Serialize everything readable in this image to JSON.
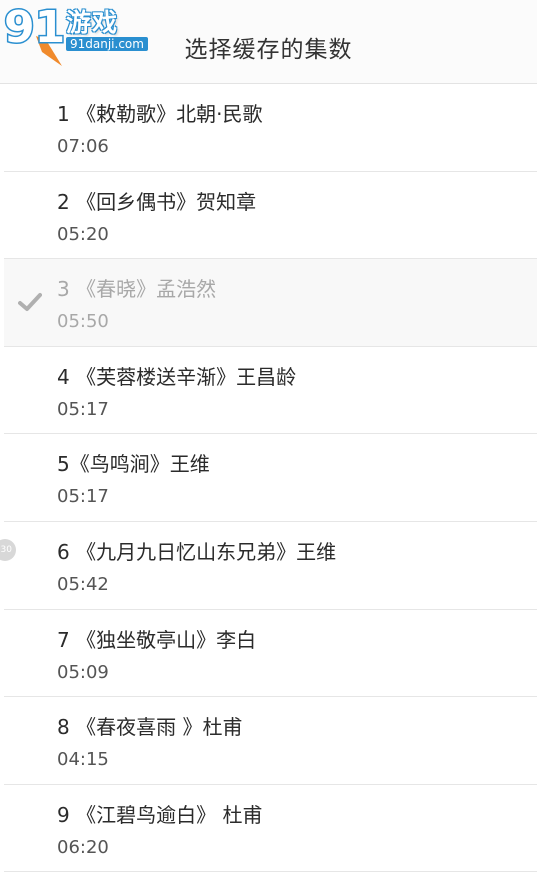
{
  "watermark": {
    "brand_number": "91",
    "brand_text": "游戏",
    "url": "91danji.com"
  },
  "header": {
    "title": "选择缓存的集数"
  },
  "episodes": [
    {
      "title": "1 《敕勒歌》北朝·民歌",
      "duration": "07:06",
      "downloaded": false
    },
    {
      "title": "2 《回乡偶书》贺知章",
      "duration": "05:20",
      "downloaded": false
    },
    {
      "title": "3 《春晓》孟浩然",
      "duration": "05:50",
      "downloaded": true
    },
    {
      "title": "4 《芙蓉楼送辛渐》王昌龄",
      "duration": "05:17",
      "downloaded": false
    },
    {
      "title": "5《鸟鸣涧》王维",
      "duration": "05:17",
      "downloaded": false
    },
    {
      "title": "6 《九月九日忆山东兄弟》王维",
      "duration": "05:42",
      "downloaded": false
    },
    {
      "title": "7 《独坐敬亭山》李白",
      "duration": "05:09",
      "downloaded": false
    },
    {
      "title": "8 《春夜喜雨 》杜甫",
      "duration": "04:15",
      "downloaded": false
    },
    {
      "title": "9 《江碧鸟逾白》 杜甫",
      "duration": "06:20",
      "downloaded": false
    }
  ],
  "icons": {
    "downloaded": "check-icon",
    "floating": "side-bubble-icon"
  },
  "colors": {
    "title": "#333333",
    "text": "#2b2b2b",
    "dim": "#a8a8a8",
    "check": "#b0b0b0",
    "brand_blue": "#2a8fd0"
  }
}
